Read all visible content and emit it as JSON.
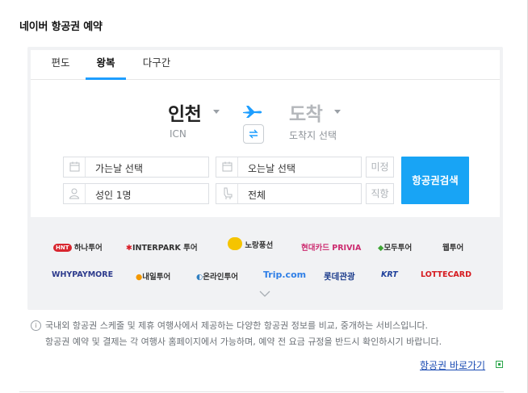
{
  "title": "네이버 항공권 예약",
  "tabs": [
    {
      "label": "편도"
    },
    {
      "label": "왕복"
    },
    {
      "label": "다구간"
    }
  ],
  "active_tab": "왕복",
  "route": {
    "from_city": "인천",
    "from_code": "ICN",
    "to_city": "도착",
    "to_code": "도착지 선택"
  },
  "form": {
    "depart_date": "가는날 선택",
    "return_date": "오는날 선택",
    "undecided_label": "미정",
    "passengers": "성인 1명",
    "seat_class": "전체",
    "direct_label": "직항",
    "search_button": "항공권검색"
  },
  "partners_row1": [
    {
      "name": "하나투어",
      "mark": "HNT",
      "color": "#d8262f"
    },
    {
      "name": "INTERPARK 투어",
      "color": "#d91c26"
    },
    {
      "name": "노랑풍선",
      "color": "#f5b400"
    },
    {
      "name": "현대카드 PRIVIA",
      "color": "#cc2b6f"
    },
    {
      "name": "모두투어",
      "color": "#3fa535"
    },
    {
      "name": "웹투어",
      "color": "#7cbb2d"
    }
  ],
  "partners_row2": [
    {
      "name": "WHYPAYMORE",
      "color": "#2c3a8c"
    },
    {
      "name": "내일투어",
      "color": "#f39800"
    },
    {
      "name": "온라인투어",
      "color": "#2f7fc1"
    },
    {
      "name": "Trip.com",
      "color": "#2f7fe6"
    },
    {
      "name": "롯데관광",
      "color": "#1c3c8c"
    },
    {
      "name": "KRT",
      "color": "#1d3f9a"
    },
    {
      "name": "LOTTECARD",
      "color": "#d61a1f"
    }
  ],
  "notice": {
    "line1": "국내외 항공권 스케줄 및 제휴 여행사에서 제공하는 다양한 항공권 정보를 비교, 중개하는 서비스입니다.",
    "line2": "항공권 예약 및 결제는 각 여행사 홈페이지에서 가능하며, 예약 전 요금 규정을 반드시 확인하시기 바랍니다."
  },
  "shortcut_link": "항공권 바로가기",
  "colors": {
    "accent": "#1e9eff",
    "search_button": "#18a4f5",
    "panel_bg": "#f1f2f4"
  }
}
